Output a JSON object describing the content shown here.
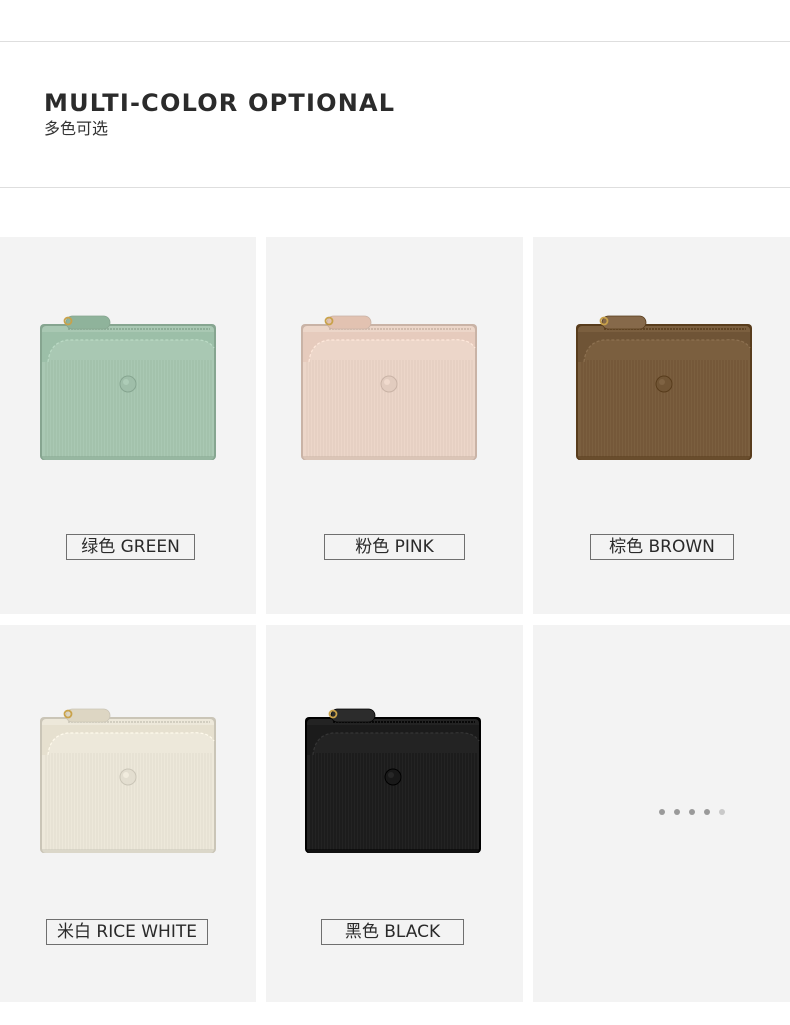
{
  "header": {
    "title": "MULTI-COLOR OPTIONAL",
    "subtitle": "多色可选"
  },
  "products": [
    {
      "label": "绿色 GREEN",
      "body_color": "#a9c8b3",
      "flap_color": "#9cbfa8",
      "pull_color": "#8fb39b"
    },
    {
      "label": "粉色 PINK",
      "body_color": "#ecd6c9",
      "flap_color": "#e6cbbd",
      "pull_color": "#e2c2b1"
    },
    {
      "label": "棕色 BROWN",
      "body_color": "#7b5f3f",
      "flap_color": "#6f5436",
      "pull_color": "#86694a"
    },
    {
      "label": "米白 RICE WHITE",
      "body_color": "#ede8da",
      "flap_color": "#e6e0cf",
      "pull_color": "#ddd6c3"
    },
    {
      "label": "黑色 BLACK",
      "body_color": "#232323",
      "flap_color": "#1b1b1b",
      "pull_color": "#2c2c2c"
    }
  ],
  "carousel": {
    "dot_count": 5,
    "active_index": 4
  }
}
